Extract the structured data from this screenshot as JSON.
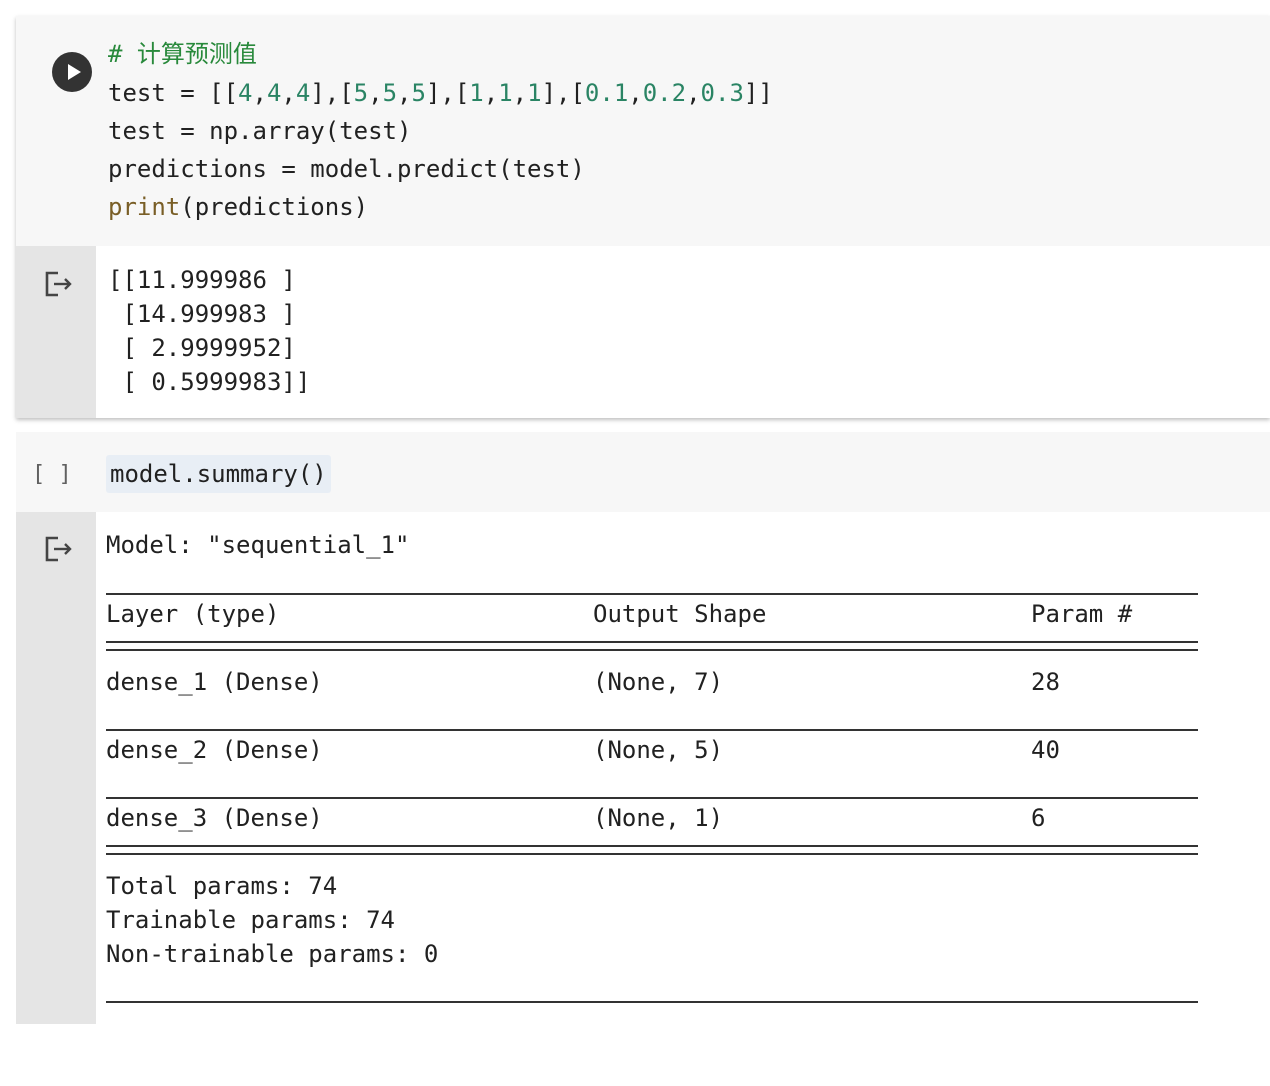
{
  "cell1": {
    "code": {
      "comment": "# 计算预测值",
      "line1_prefix": "test = [[",
      "line1_nums": [
        "4",
        "4",
        "4",
        "5",
        "5",
        "5",
        "1",
        "1",
        "1",
        "0.1",
        "0.2",
        "0.3"
      ],
      "line2": "test = np.array(test)",
      "line3": "predictions = model.predict(test)",
      "line4_builtin": "print",
      "line4_rest": "(predictions)"
    },
    "output": [
      "[[11.999986 ]",
      " [14.999983 ]",
      " [ 2.9999952]",
      " [ 0.5999983]]"
    ]
  },
  "cell2": {
    "bracket": "[ ]",
    "code": "model.summary()",
    "summary": {
      "model_line": "Model: \"sequential_1\"",
      "headers": {
        "layer": "Layer (type)",
        "shape": "Output Shape",
        "param": "Param #"
      },
      "rows": [
        {
          "layer": "dense_1 (Dense)",
          "shape": "(None, 7)",
          "param": "28"
        },
        {
          "layer": "dense_2 (Dense)",
          "shape": "(None, 5)",
          "param": "40"
        },
        {
          "layer": "dense_3 (Dense)",
          "shape": "(None, 1)",
          "param": "6"
        }
      ],
      "total": "Total params: 74",
      "trainable": "Trainable params: 74",
      "non_trainable": "Non-trainable params: 0"
    }
  }
}
